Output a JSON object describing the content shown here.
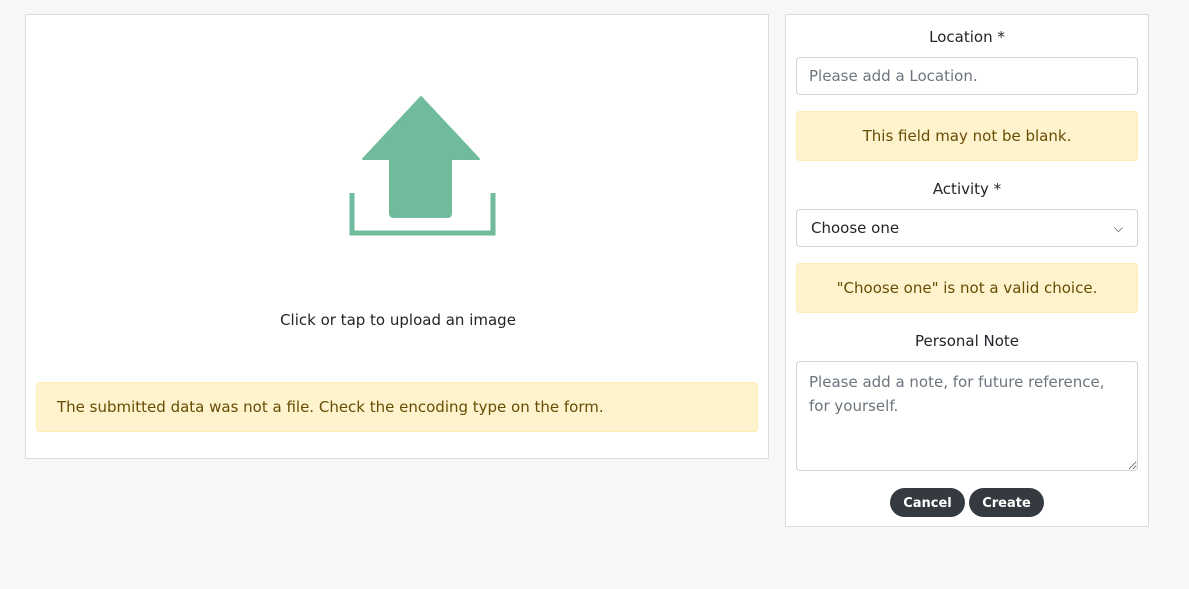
{
  "upload": {
    "label": "Click or tap to upload an image",
    "error": "The submitted data was not a file. Check the encoding type on the form.",
    "icon": "upload-icon",
    "icon_color": "#6fbb9c"
  },
  "form": {
    "location": {
      "label": "Location *",
      "placeholder": "Please add a Location.",
      "value": "",
      "error": "This field may not be blank."
    },
    "activity": {
      "label": "Activity *",
      "selected": "Choose one",
      "error": "\"Choose one\" is not a valid choice."
    },
    "note": {
      "label": "Personal Note",
      "placeholder": "Please add a note, for future reference, for yourself.",
      "value": ""
    },
    "buttons": {
      "cancel": "Cancel",
      "create": "Create"
    }
  },
  "colors": {
    "alert_bg": "#fff3cd",
    "alert_text": "#664d03",
    "button_bg": "#343a40"
  }
}
